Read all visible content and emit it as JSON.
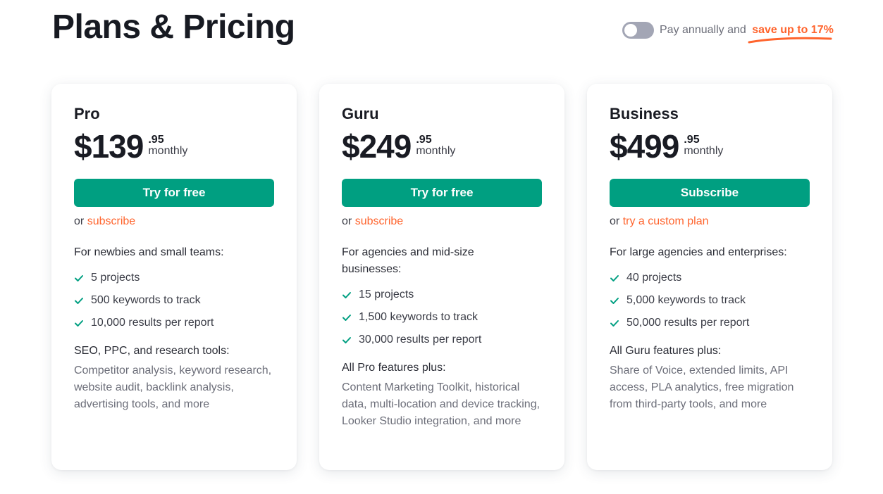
{
  "header": {
    "title": "Plans & Pricing",
    "billing_toggle": {
      "enabled": false,
      "label": "Pay annually and",
      "highlight": "save up to 17%"
    }
  },
  "colors": {
    "accent_green": "#009f81",
    "accent_orange": "#ff642d",
    "toggle_off": "#a3a6b5"
  },
  "plans": [
    {
      "name": "Pro",
      "price_main": "$139",
      "price_cents": ".95",
      "period": "monthly",
      "cta_label": "Try for free",
      "alt_prefix": "or",
      "alt_link": "subscribe",
      "audience": "For newbies and small teams:",
      "features": [
        "5 projects",
        "500 keywords to track",
        "10,000 results per report"
      ],
      "group_title": "SEO, PPC, and research tools:",
      "group_desc": "Competitor analysis, keyword research, website audit, backlink analysis, advertising tools, and more"
    },
    {
      "name": "Guru",
      "price_main": "$249",
      "price_cents": ".95",
      "period": "monthly",
      "cta_label": "Try for free",
      "alt_prefix": "or",
      "alt_link": "subscribe",
      "audience": "For agencies and mid-size businesses:",
      "features": [
        "15 projects",
        "1,500 keywords to track",
        "30,000 results per report"
      ],
      "group_title": "All Pro features plus:",
      "group_desc": "Content Marketing Toolkit, historical data, multi-location and device tracking, Looker Studio integration, and more"
    },
    {
      "name": "Business",
      "price_main": "$499",
      "price_cents": ".95",
      "period": "monthly",
      "cta_label": "Subscribe",
      "alt_prefix": "or",
      "alt_link": "try a custom plan",
      "audience": "For large agencies and enterprises:",
      "features": [
        "40 projects",
        "5,000 keywords to track",
        "50,000 results per report"
      ],
      "group_title": "All Guru features plus:",
      "group_desc": "Share of Voice, extended limits, API access, PLA analytics, free migration from third-party tools, and more"
    }
  ]
}
